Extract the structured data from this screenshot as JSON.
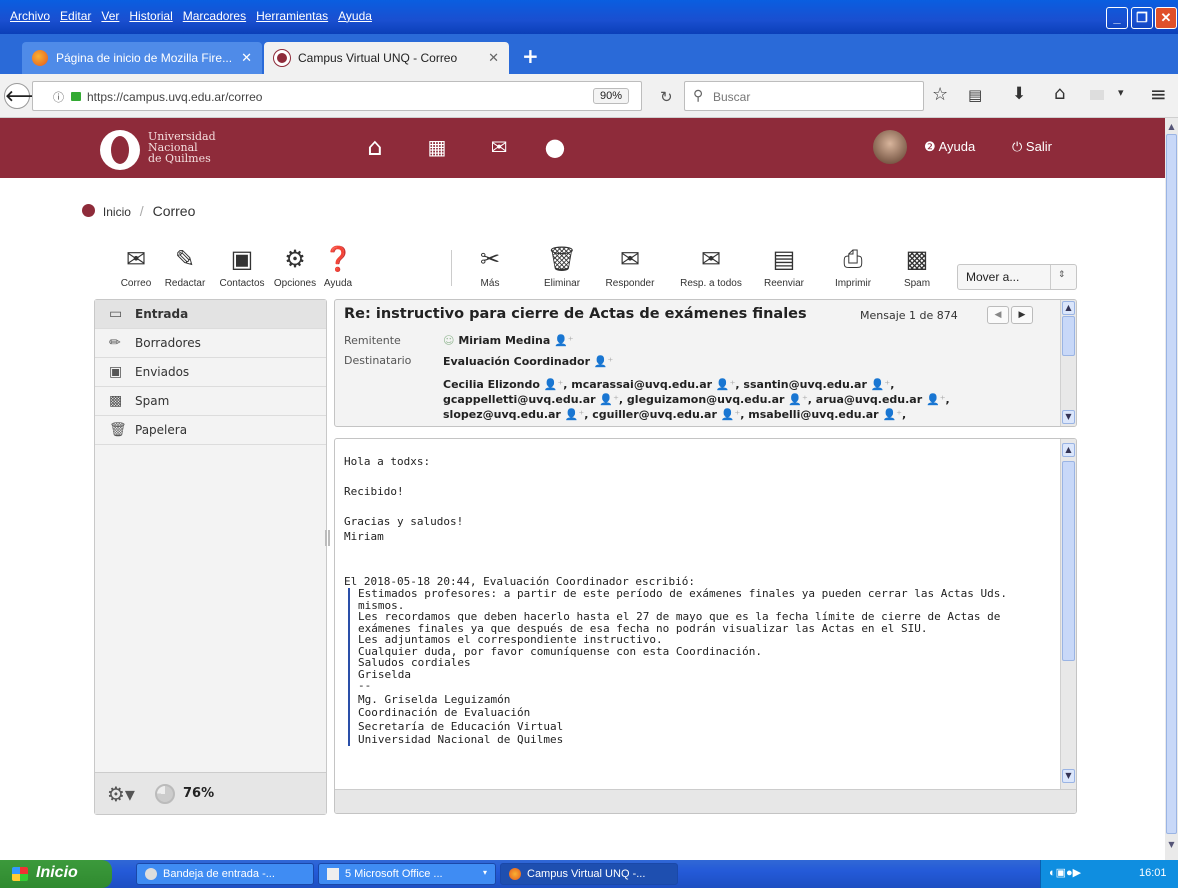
{
  "menu": [
    "Archivo",
    "Editar",
    "Ver",
    "Historial",
    "Marcadores",
    "Herramientas",
    "Ayuda"
  ],
  "tabs": [
    {
      "label": "Página de inicio de Mozilla Fire...",
      "close": "✕"
    },
    {
      "label": "Campus Virtual UNQ - Correo",
      "close": "✕"
    }
  ],
  "new_tab": "+",
  "address": {
    "url": "https://campus.uvq.edu.ar/correo",
    "zoom": "90%",
    "search_placeholder": "Buscar"
  },
  "header": {
    "logo_line1": "Universidad",
    "logo_line2": "Nacional",
    "logo_line3": "de Quilmes",
    "help": "Ayuda",
    "logout": "Salir"
  },
  "breadcrumb": {
    "home": "Inicio",
    "sep": "/",
    "current": "Correo"
  },
  "toolbar": {
    "correo": "Correo",
    "redactar": "Redactar",
    "contactos": "Contactos",
    "opciones": "Opciones",
    "ayuda": "Ayuda",
    "mas": "Más",
    "eliminar": "Eliminar",
    "responder": "Responder",
    "resp_todos": "Resp. a todos",
    "reenviar": "Reenviar",
    "imprimir": "Imprimir",
    "spam": "Spam",
    "mover": "Mover a..."
  },
  "folders": [
    {
      "label": "Entrada",
      "icon": "inbox-icon"
    },
    {
      "label": "Borradores",
      "icon": "pencil-icon"
    },
    {
      "label": "Enviados",
      "icon": "sent-icon"
    },
    {
      "label": "Spam",
      "icon": "spam-icon"
    },
    {
      "label": "Papelera",
      "icon": "trash-icon"
    }
  ],
  "quota": "76%",
  "message": {
    "subject": "Re: instructivo para cierre de Actas de exámenes finales",
    "counter": "Mensaje 1 de 874",
    "from_label": "Remitente",
    "from": "Miriam Medina",
    "to_label": "Destinatario",
    "to": "Evaluación Coordinador",
    "cc_line1": [
      "Cecilia Elizondo",
      ", mcarassai@uvq.edu.ar",
      ", ssantin@uvq.edu.ar",
      ","
    ],
    "cc_line2": [
      "gcappelletti@uvq.edu.ar",
      ", gleguizamon@uvq.edu.ar",
      ", arua@uvq.edu.ar",
      ","
    ],
    "cc_line3": [
      "slopez@uvq.edu.ar",
      ", cguiller@uvq.edu.ar",
      ", msabelli@uvq.edu.ar",
      ","
    ],
    "body_lines": [
      "Hola a todxs:",
      "",
      "Recibido!",
      "",
      "Gracias y saludos!",
      "Miriam",
      "",
      "",
      "El 2018-05-18 20:44, Evaluación Coordinador escribió:"
    ],
    "quote_lines": [
      "Estimados profesores: a partir de este período de exámenes finales ya pueden cerrar las Actas Uds.",
      "mismos.",
      "Les recordamos que deben hacerlo hasta el 27 de mayo que es la fecha límite de cierre de Actas de",
      "exámenes finales ya que después de esa fecha no podrán visualizar las Actas en el SIU.",
      "Les adjuntamos el correspondiente instructivo.",
      "Cualquier duda, por favor comuníquense con esta Coordinación.",
      "Saludos cordiales",
      "Griselda",
      "--",
      "Mg. Griselda Leguizamón",
      "Coordinación de Evaluación",
      "Secretaría de Educación Virtual",
      "Universidad Nacional de Quilmes"
    ]
  },
  "taskbar": {
    "start": "Inicio",
    "items": [
      "Bandeja de entrada -...",
      "5 Microsoft Office ...",
      "Campus Virtual UNQ -..."
    ],
    "clock": "16:01"
  }
}
